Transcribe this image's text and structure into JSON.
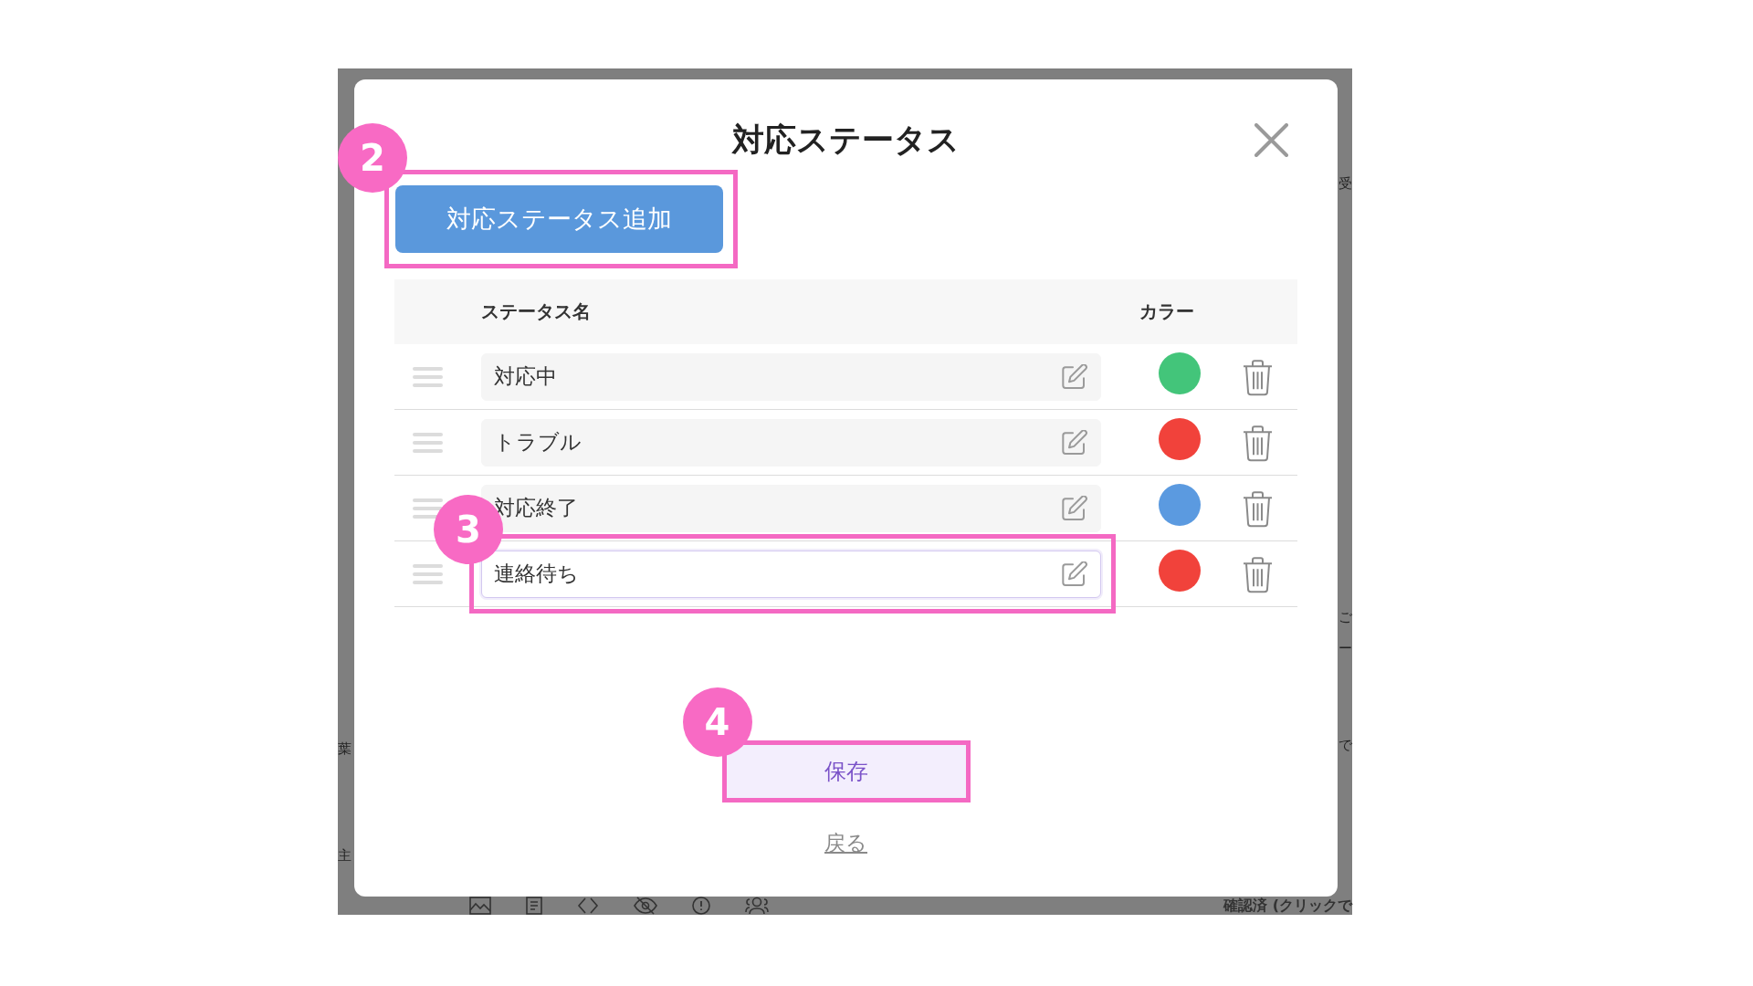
{
  "backdrop": {
    "left_texts": [
      "葉",
      "主"
    ],
    "right_texts": [
      "受",
      "ご",
      "ー",
      "で"
    ],
    "bottom_text": "確認済 (クリックで"
  },
  "dialog": {
    "title": "対応ステータス",
    "add_button": {
      "label": "対応ステータス追加",
      "step": "2"
    },
    "table": {
      "columns": [
        "ステータス名",
        "カラー"
      ],
      "rows": [
        {
          "name": "対応中",
          "color": "#43c57a",
          "focused": false
        },
        {
          "name": "トラブル",
          "color": "#f1423b",
          "focused": false
        },
        {
          "name": "対応終了",
          "color": "#5b9ae0",
          "focused": false
        },
        {
          "name": "連絡待ち",
          "color": "#f1423b",
          "focused": true,
          "step": "3"
        }
      ]
    },
    "save_button": {
      "label": "保存",
      "step": "4"
    },
    "back_link": "戻る"
  }
}
